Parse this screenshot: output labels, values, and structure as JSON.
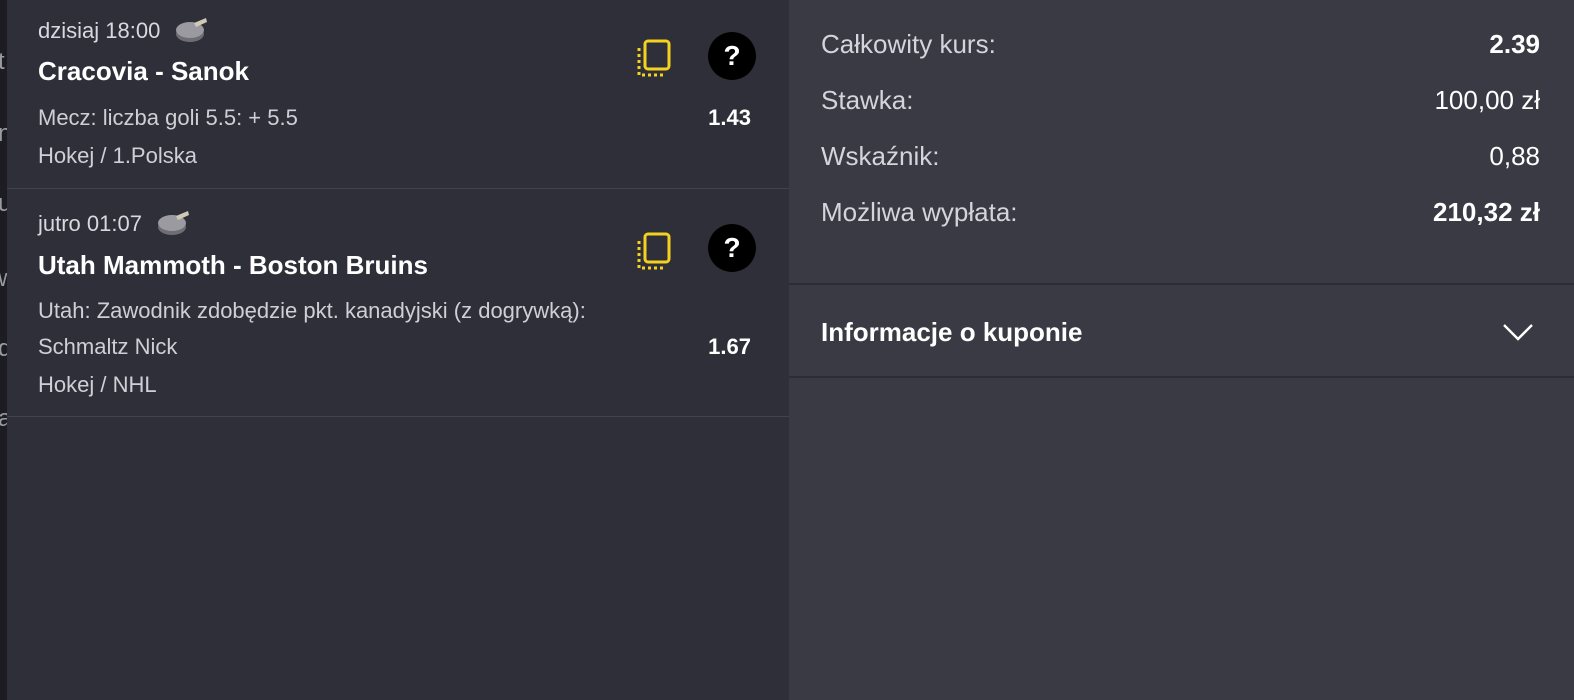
{
  "bets": [
    {
      "time": "dzisiaj 18:00",
      "title": "Cracovia - Sanok",
      "market": "Mecz: liczba goli 5.5: + 5.5",
      "selection": "",
      "odds": "1.43",
      "league": "Hokej / 1.Polska",
      "icons": {
        "copy": "copy-icon",
        "help": "help-icon",
        "sport": "puck-icon"
      }
    },
    {
      "time": "jutro 01:07",
      "title": "Utah Mammoth - Boston Bruins",
      "market": "Utah: Zawodnik zdobędzie pkt. kanadyjski (z dogrywką):",
      "selection": "Schmaltz Nick",
      "odds": "1.67",
      "league": "Hokej / NHL",
      "icons": {
        "copy": "copy-icon",
        "help": "help-icon",
        "sport": "puck-icon"
      }
    }
  ],
  "help_glyph": "?",
  "summary": {
    "total_odds_label": "Całkowity kurs:",
    "total_odds_value": "2.39",
    "stake_label": "Stawka:",
    "stake_value": "100,00 zł",
    "indicator_label": "Wskaźnik:",
    "indicator_value": "0,88",
    "payout_label": "Możliwa wypłata:",
    "payout_value": "210,32 zł"
  },
  "coupon_info": {
    "label": "Informacje o kuponie",
    "icon": "chevron-down-icon"
  },
  "colors": {
    "left_bg": "#2f2f39",
    "right_bg": "#3a3a44",
    "accent_yellow": "#f5d21e",
    "help_bg": "#000000"
  }
}
